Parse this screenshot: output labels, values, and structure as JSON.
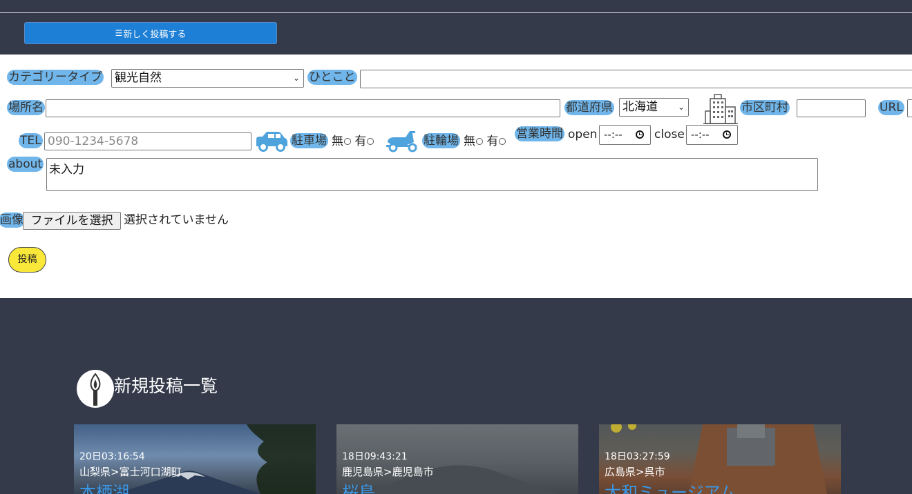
{
  "header": {
    "new_post_button": "新しく投稿する"
  },
  "form": {
    "category_label": "カテゴリータイプ",
    "category_value": "観光自然",
    "comment_label": "ひとこと",
    "place_label": "場所名",
    "prefecture_label": "都道府県",
    "prefecture_value": "北海道",
    "city_label": "市区町村",
    "url_label": "URL",
    "tel_label": "TEL",
    "tel_placeholder": "090-1234-5678",
    "parking_label": "駐車場",
    "bike_parking_label": "駐輪場",
    "none_label": "無",
    "yes_label": "有",
    "hours_label": "営業時間",
    "open_label": "open",
    "close_label": "close",
    "time_placeholder": "--:--",
    "about_label": "about",
    "about_value": "未入力",
    "image_label": "画像",
    "file_button": "ファイルを選択",
    "file_status": "選択されていません",
    "submit_button": "投稿"
  },
  "list": {
    "title": "新規投稿一覧",
    "cards": [
      {
        "timestamp": "20日03:16:54",
        "location": "山梨県>富士河口湖町",
        "name": "本栖湖"
      },
      {
        "timestamp": "18日09:43:21",
        "location": "鹿児島県>鹿児島市",
        "name": "桜島"
      },
      {
        "timestamp": "18日03:27:59",
        "location": "広島県>呉市",
        "name": "大和ミュージアム"
      }
    ]
  },
  "colors": {
    "background": "#343a4a",
    "label_highlight": "#70b6ea",
    "primary_button": "#1e7fd6",
    "submit_button": "#f9e73a",
    "card_title": "#3b97e6"
  },
  "icons": [
    "list-icon",
    "building-icon",
    "car-icon",
    "scooter-icon",
    "clock-icon",
    "candle-icon"
  ]
}
